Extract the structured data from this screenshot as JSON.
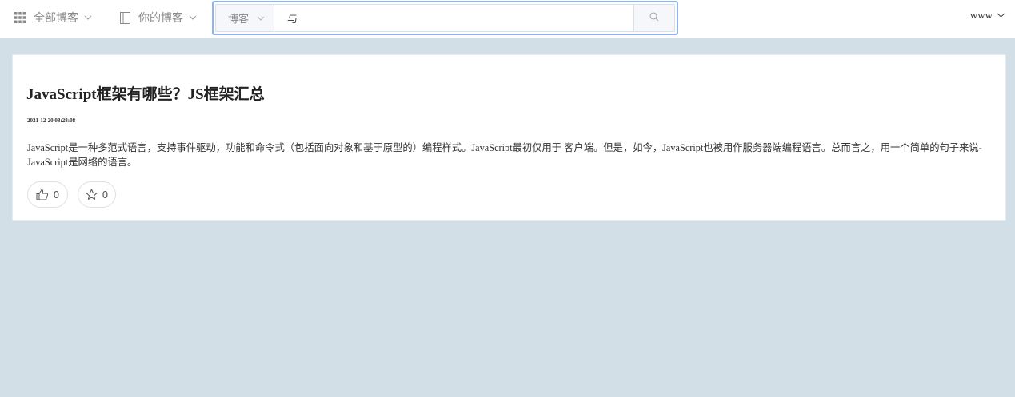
{
  "topbar": {
    "all_blogs_label": "全部博客",
    "my_blogs_label": "你的博客",
    "user_name": "www"
  },
  "search": {
    "type_label": "博客",
    "query": "与"
  },
  "post": {
    "title": "JavaScript框架有哪些？JS框架汇总",
    "date": "2021-12-20 08:28:08",
    "summary": "JavaScript是一种多范式语言，支持事件驱动，功能和命令式（包括面向对象和基于原型的）编程样式。JavaScript最初仅用于 客户端。但是，如今，JavaScript也被用作服务器端编程语言。总而言之，用一个简单的句子来说-JavaScript是网络的语言。",
    "like_count": "0",
    "favorite_count": "0"
  },
  "icons": {
    "grid": "grid-icon",
    "notebook": "notebook-icon",
    "chevron": "chevron-down-icon",
    "search": "search-icon",
    "like": "thumbs-up-icon",
    "favorite": "star-icon"
  },
  "colors": {
    "page_background": "#d3dfe6",
    "search_focus_border": "#8fb3ee",
    "muted_text": "#8a8a8a"
  }
}
